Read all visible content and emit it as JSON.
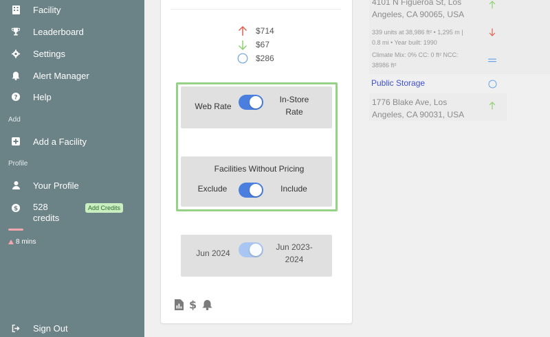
{
  "sidebar": {
    "items": [
      {
        "label": "Facility",
        "icon": "building-icon"
      },
      {
        "label": "Leaderboard",
        "icon": "trophy-icon"
      },
      {
        "label": "Settings",
        "icon": "gear-icon"
      },
      {
        "label": "Alert Manager",
        "icon": "bell-icon"
      },
      {
        "label": "Help",
        "icon": "help-icon"
      }
    ],
    "add_section": "Add",
    "add_facility": "Add a Facility",
    "profile_section": "Profile",
    "your_profile": "Your Profile",
    "credits_count": "528",
    "credits_word": "credits",
    "add_credits": "Add Credits",
    "timer": "8 mins",
    "sign_out": "Sign Out"
  },
  "prices": {
    "up": "$714",
    "down": "$67",
    "neutral": "$286"
  },
  "rate_toggle": {
    "left_label": "Web Rate",
    "right_label": "In-Store Rate"
  },
  "pricing_toggle": {
    "title": "Facilities Without Pricing",
    "left_label": "Exclude",
    "right_label": "Include"
  },
  "date_toggle": {
    "left_label": "Jun 2024",
    "right_label": "Jun 2023-2024"
  },
  "right_panel": {
    "address1_line1": "4101 N Figueroa St, Los",
    "address1_line2": "Angeles, CA 90065, USA",
    "details_line1": "339 units at 38,986 ft² • 1,295 m |",
    "details_line2": "0.8 mi • Year built: 1990",
    "climate_line1": "Climate Mix: 0% CC: 0 ft² NCC:",
    "climate_line2": "38986 ft²",
    "facility_name": "Public Storage",
    "address2_line1": "1776 Blake Ave, Los",
    "address2_line2": "Angeles, CA 90031, USA"
  },
  "colors": {
    "sidebar_bg": "#6b8287",
    "toggle_blue": "#4a7fe0",
    "highlight_green": "#95d287",
    "up_arrow": "#e2614f",
    "down_arrow": "#8fd06f",
    "link_blue": "#3b4ed6"
  }
}
